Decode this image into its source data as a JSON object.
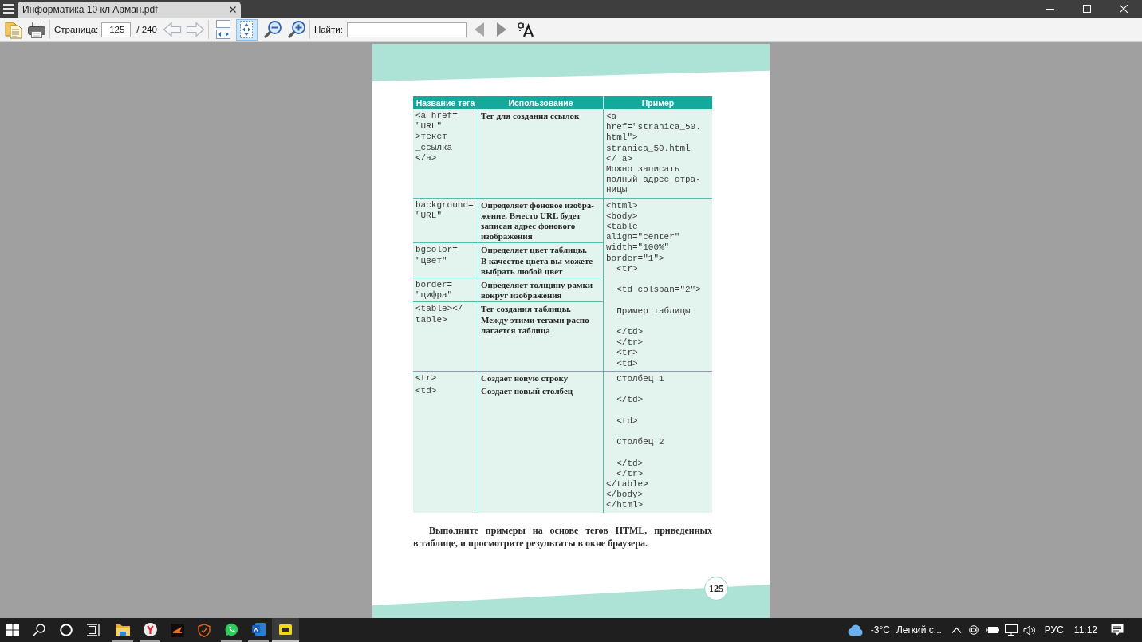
{
  "tabs": [
    {
      "label": "Информатика 10 кл Арман.pdf",
      "selected": true
    }
  ],
  "toolbar": {
    "page_label": "Страница:",
    "page_value": "125",
    "page_total": "/ 240",
    "fit_modes": [
      {
        "kind": "width",
        "selected": false
      },
      {
        "kind": "page",
        "selected": true
      }
    ],
    "find_label": "Найти:"
  },
  "page": {
    "table": {
      "columns": [
        "Название тега",
        "Использование",
        "Пример"
      ],
      "groups": [
        {
          "rows": [
            {
              "tag": "<a href=\n\"URL\"\n>текст\n_ссылка\n</a>",
              "usage": "Тег для создания ссылок"
            }
          ],
          "example": "<a\nhref=\"stranica_50.\nhtml\">\nstranica_50.html\n</ a>\nМожно записать\nполный адрес стра-\nницы"
        },
        {
          "rows": [
            {
              "tag": "background=\n\"URL\"",
              "usage": "Определяет фоновое изобра-\nжение. Вместо URL будет\nзаписан адрес фонового\nизображения"
            },
            {
              "tag": "bgcolor=\n\"цвет\"",
              "usage": "Определяет цвет таблицы.\nВ качестве цвета вы можете\nвыбрать любой цвет"
            },
            {
              "tag": "border=\n\"цифра\"",
              "usage": "Определяет толщину рамки\nвокруг изображения"
            },
            {
              "tag": "<table></\ntable>",
              "usage": "Тег создания таблицы.\nМежду этими тегами распо-\nлагается таблица"
            }
          ],
          "example": "<html>\n<body>\n<table\nalign=\"center\"\nwidth=\"100%\"\nborder=\"1\">\n  <tr>\n\n  <td colspan=\"2\">\n\n  Пример таблицы\n\n  </td>\n  </tr>\n  <tr>\n  <td>"
        },
        {
          "rows": [
            {
              "tag": "<tr>",
              "usage": "Создает новую строку"
            },
            {
              "tag": "<td>",
              "usage": "Создает новый столбец"
            }
          ],
          "example": "  Столбец 1\n\n  </td>\n\n  <td>\n\n  Столбец 2\n\n  </td>\n  </tr>\n</table>\n</body>\n</html>"
        }
      ]
    },
    "note": "Выполните примеры на основе тегов HTML, приведенных\nв таблице, и просмотрите результаты в окне браузера.",
    "page_number": "125"
  },
  "taskbar": {
    "apps": [
      {
        "kind": "folder",
        "running": true,
        "selected": false
      },
      {
        "kind": "browser",
        "running": true,
        "selected": false
      },
      {
        "kind": "media",
        "running": false,
        "selected": false
      },
      {
        "kind": "shield",
        "running": false,
        "selected": false
      },
      {
        "kind": "chat",
        "running": true,
        "selected": false
      },
      {
        "kind": "word",
        "running": true,
        "selected": false
      },
      {
        "kind": "reader",
        "running": true,
        "selected": true
      }
    ],
    "weather": {
      "temperature": "-3°C",
      "summary": "Легкий с..."
    },
    "language": "РУС",
    "time": "11:12"
  }
}
